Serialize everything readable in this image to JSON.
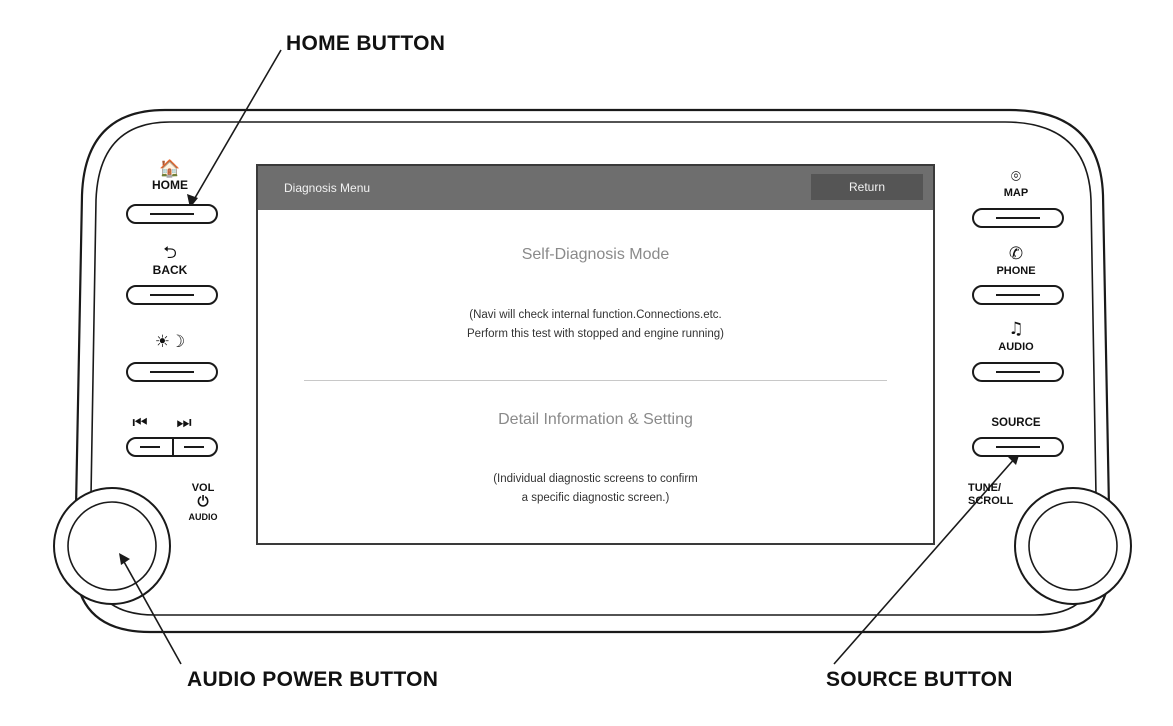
{
  "callouts": {
    "home": "HOME BUTTON",
    "audio_power": "AUDIO POWER BUTTON",
    "source": "SOURCE BUTTON"
  },
  "left_buttons": {
    "home": {
      "label": "HOME",
      "icon": "home-icon",
      "glyph": "🏠"
    },
    "back": {
      "label": "BACK",
      "icon": "back-arrow-icon",
      "glyph": "⮌"
    },
    "brightness": {
      "label": "",
      "icon": "day-night-icon",
      "glyph": "☀☽"
    },
    "skip": {
      "icon": "skip-track-icons",
      "glyph_prev": "⏮",
      "glyph_next": "⏭"
    },
    "vol": {
      "label_top": "VOL",
      "glyph": "⏻",
      "label_bottom": "AUDIO"
    }
  },
  "right_buttons": {
    "map": {
      "label": "MAP",
      "icon": "map-pin-icon",
      "glyph": "⌾"
    },
    "phone": {
      "label": "PHONE",
      "icon": "phone-icon",
      "glyph": "✆"
    },
    "audio": {
      "label": "AUDIO",
      "icon": "music-note-icon",
      "glyph": "♫"
    },
    "source": {
      "label": "SOURCE"
    },
    "tune": {
      "label_line1": "TUNE/",
      "label_line2": "SCROLL"
    }
  },
  "screen": {
    "title": "Diagnosis Menu",
    "return_label": "Return",
    "items": [
      {
        "title": "Self-Diagnosis Mode",
        "line1": "(Navi will check internal function.Connections.etc.",
        "line2": "Perform this test with stopped and engine running)"
      },
      {
        "title": "Detail Information & Setting",
        "line1": "(Individual diagnostic screens to confirm",
        "line2": "a specific diagnostic screen.)"
      }
    ],
    "colors": {
      "header": "#6e6e6e",
      "return_button": "#555555",
      "heading_text": "#8a8a8a"
    }
  }
}
